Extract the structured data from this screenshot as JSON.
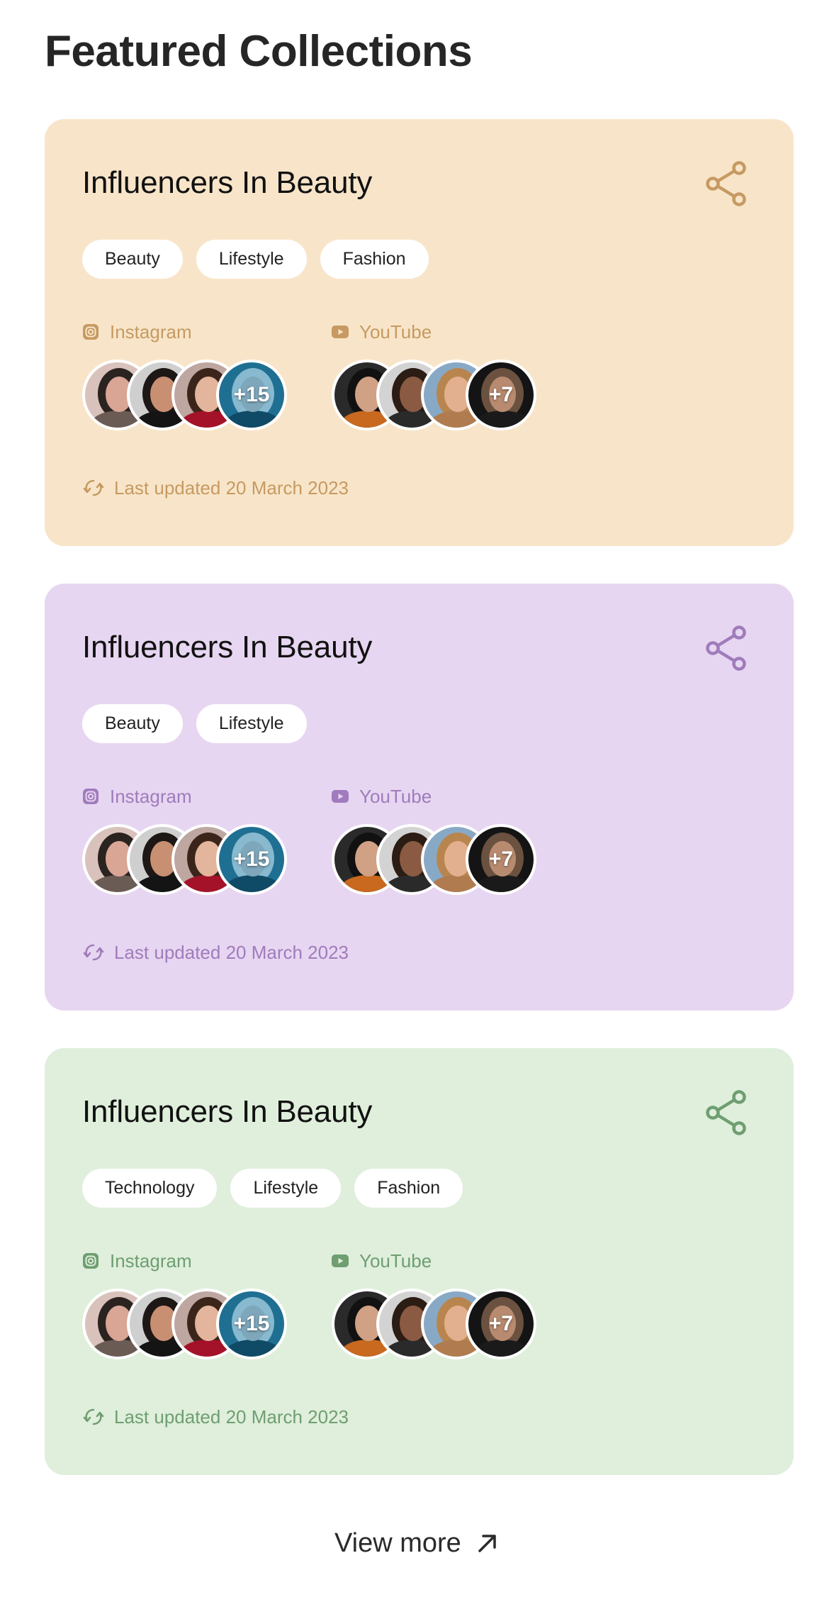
{
  "page": {
    "title": "Featured Collections",
    "view_more_label": "View more"
  },
  "cards": [
    {
      "title": "Influencers In Beauty",
      "background": "#f8e5c9",
      "accent": "#c69a62",
      "tags": [
        "Beauty",
        "Lifestyle",
        "Fashion"
      ],
      "platforms": [
        {
          "name": "Instagram",
          "icon": "instagram-icon",
          "more_count": "+15"
        },
        {
          "name": "YouTube",
          "icon": "youtube-icon",
          "more_count": "+7"
        }
      ],
      "updated_text": "Last updated 20 March 2023"
    },
    {
      "title": "Influencers In Beauty",
      "background": "#e7d6f1",
      "accent": "#a07cbc",
      "tags": [
        "Beauty",
        "Lifestyle"
      ],
      "platforms": [
        {
          "name": "Instagram",
          "icon": "instagram-icon",
          "more_count": "+15"
        },
        {
          "name": "YouTube",
          "icon": "youtube-icon",
          "more_count": "+7"
        }
      ],
      "updated_text": "Last updated 20 March 2023"
    },
    {
      "title": "Influencers In Beauty",
      "background": "#dfefdc",
      "accent": "#6f9e70",
      "tags": [
        "Technology",
        "Lifestyle",
        "Fashion"
      ],
      "platforms": [
        {
          "name": "Instagram",
          "icon": "instagram-icon",
          "more_count": "+15"
        },
        {
          "name": "YouTube",
          "icon": "youtube-icon",
          "more_count": "+7"
        }
      ],
      "updated_text": "Last updated 20 March 2023"
    }
  ],
  "icons": {
    "share": "share-icon",
    "refresh": "refresh-icon",
    "view_more": "arrow-up-right-icon"
  }
}
